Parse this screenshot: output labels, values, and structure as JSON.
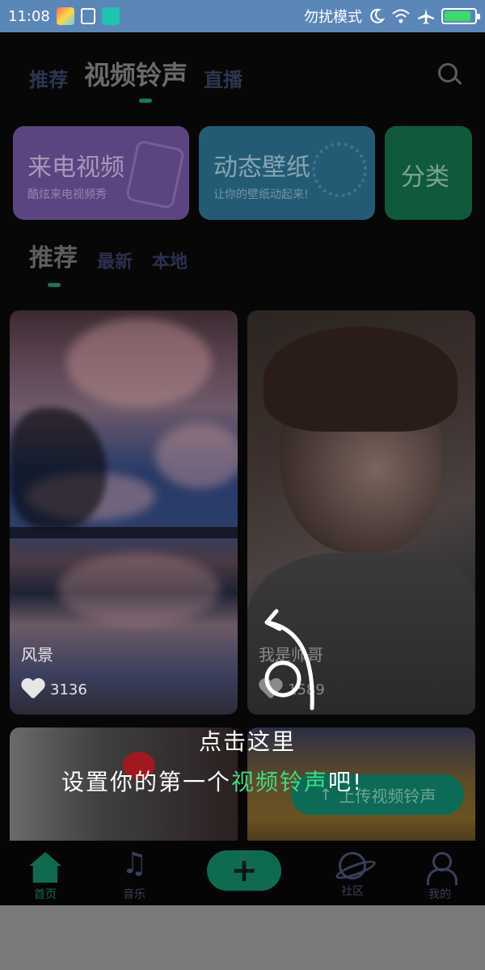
{
  "status_bar": {
    "time": "11:08",
    "mode_text": "勿扰模式",
    "icons": [
      "app-icon-1",
      "cleaner-icon",
      "usb-icon",
      "moon-icon",
      "wifi-icon",
      "airplane-icon",
      "battery-icon"
    ],
    "battery_level": 0.9
  },
  "header": {
    "tabs": [
      {
        "label": "推荐",
        "active": false
      },
      {
        "label": "视频铃声",
        "active": true
      },
      {
        "label": "直播",
        "active": false
      }
    ]
  },
  "categories": [
    {
      "title": "来电视频",
      "subtitle": "酷炫来电视频秀"
    },
    {
      "title": "动态壁纸",
      "subtitle": "让你的壁纸动起来!"
    },
    {
      "title": "分类",
      "subtitle": ""
    }
  ],
  "sub_tabs": [
    {
      "label": "推荐",
      "active": true
    },
    {
      "label": "最新",
      "active": false
    },
    {
      "label": "本地",
      "active": false
    }
  ],
  "cards": [
    {
      "title": "风景",
      "likes": "3136"
    },
    {
      "title": "我是帅哥",
      "likes": "1589"
    }
  ],
  "upload_button": {
    "label": "上传视频铃声"
  },
  "bottom_nav": [
    {
      "label": "首页",
      "active": true
    },
    {
      "label": "音乐",
      "active": false
    },
    {
      "label": "社区",
      "active": false
    },
    {
      "label": "我的",
      "active": false
    }
  ],
  "guide": {
    "line1": "点击这里",
    "line2_prefix": "设置你的第一个",
    "line2_highlight": "视频铃声",
    "line2_suffix": "吧!"
  },
  "colors": {
    "accent": "#3ddc84",
    "status_bar": "#5b86b8",
    "nav_active": "#0f6b50"
  }
}
